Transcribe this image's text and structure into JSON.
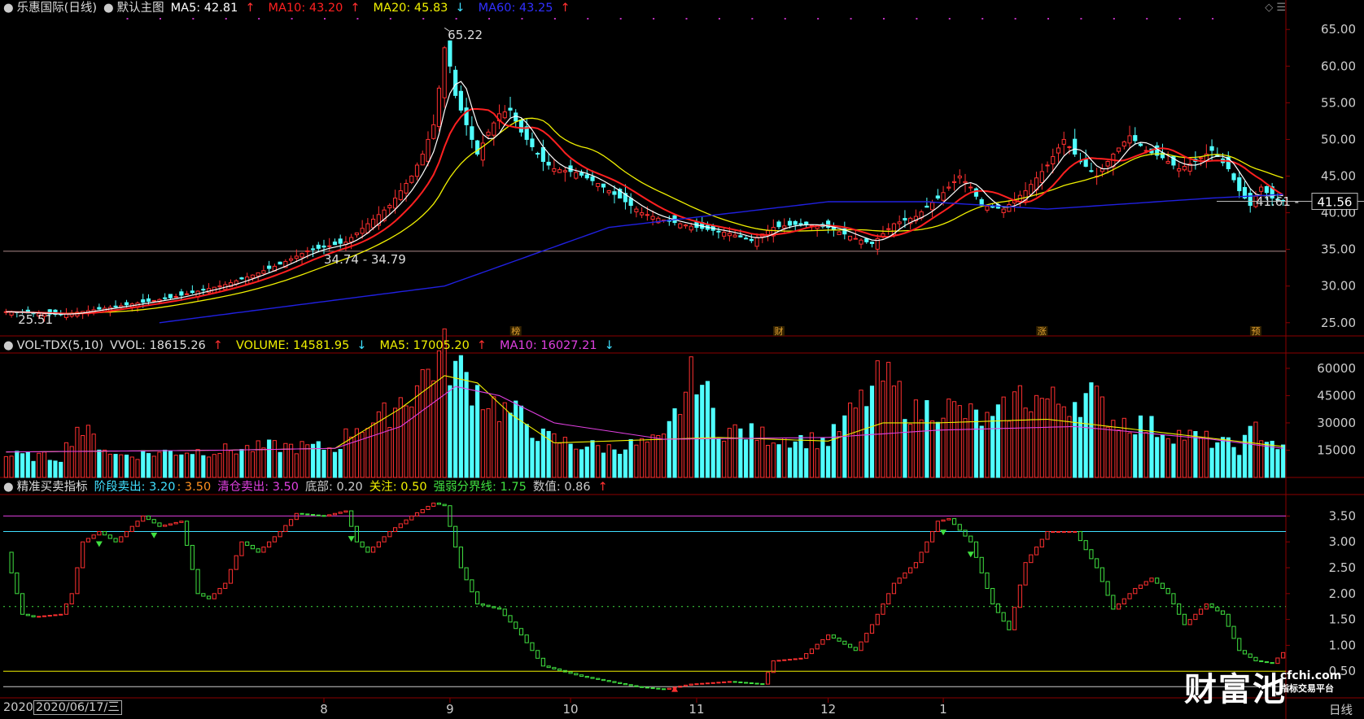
{
  "header1": {
    "stock": "乐惠国际(日线)",
    "template": "默认主图",
    "ma5": {
      "label": "MA5: 42.81",
      "dir": "up",
      "color": "#ffffff"
    },
    "ma10": {
      "label": "MA10: 43.20",
      "dir": "up",
      "color": "#ff2020"
    },
    "ma20": {
      "label": "MA20: 45.83",
      "dir": "down",
      "color": "#f0f000"
    },
    "ma60": {
      "label": "MA60: 43.25",
      "dir": "up",
      "color": "#2020ff"
    }
  },
  "header2": {
    "name": "VOL-TDX(5,10)",
    "vvol": {
      "label": "VVOL: 18615.26",
      "dir": "up",
      "color": "#dddddd"
    },
    "volume": {
      "label": "VOLUME: 14581.95",
      "dir": "down",
      "color": "#f0f000"
    },
    "ma5": {
      "label": "MA5: 17005.20",
      "dir": "up",
      "color": "#f0f000"
    },
    "ma10": {
      "label": "MA10: 16027.21",
      "dir": "down",
      "color": "#e040e0"
    }
  },
  "header3": {
    "name": "精准买卖指标",
    "stage_sell": {
      "label": "阶段卖出: 3.20",
      "color": "#40e0ff"
    },
    "stage_sell2": {
      "label": ": 3.50",
      "color": "#ff9020"
    },
    "clear_sell": {
      "label": "清仓卖出: 3.50",
      "color": "#e040e0"
    },
    "bottom": {
      "label": "底部: 0.20",
      "color": "#cccccc"
    },
    "watch": {
      "label": "关注: 0.50",
      "color": "#f0f000"
    },
    "divider": {
      "label": "强弱分界线: 1.75",
      "color": "#40e040"
    },
    "value": {
      "label": "数值: 0.86",
      "dir": "up",
      "color": "#cccccc"
    }
  },
  "footer": {
    "date_prefix": "2020",
    "date": "2020/06/17/三",
    "period": "日线"
  },
  "watermark": {
    "main": "财富池",
    "url": "cfchi.com",
    "sub": "指标交易平台"
  },
  "colors": {
    "up": "#ff3030",
    "down": "#50ffff",
    "ma5": "#ffffff",
    "ma10": "#ff2020",
    "ma20": "#f0f000",
    "ma60": "#2020e0",
    "bg": "#000000",
    "grid": "#8b0000"
  },
  "chart_data": [
    {
      "type": "candlestick",
      "panel": "price",
      "y_ticks": [
        25.0,
        30.0,
        35.0,
        40.0,
        45.0,
        50.0,
        55.0,
        60.0,
        65.0
      ],
      "ylim": [
        23.2,
        66.8
      ],
      "x_labels": [
        "8",
        "9",
        "10",
        "11",
        "12",
        "1"
      ],
      "annotations": [
        {
          "text": "65.22",
          "value": 65.22
        },
        {
          "text": "34.74 - 34.79",
          "value": 34.75
        },
        {
          "text": "25.51",
          "value": 25.51
        },
        {
          "text": "41.61 -",
          "value": 41.61
        }
      ],
      "current_price": {
        "text": "41.56",
        "value": 41.56
      },
      "h_line": 34.75,
      "markers": [
        "榜",
        "财",
        "涨",
        "预"
      ],
      "close_points": [
        [
          0,
          26.5
        ],
        [
          10,
          26.1
        ],
        [
          20,
          27.2
        ],
        [
          30,
          28.4
        ],
        [
          40,
          30.2
        ],
        [
          45,
          31.5
        ],
        [
          50,
          33.0
        ],
        [
          55,
          34.8
        ],
        [
          62,
          36.0
        ],
        [
          66,
          38.5
        ],
        [
          70,
          41.0
        ],
        [
          74,
          45.0
        ],
        [
          76,
          48.0
        ],
        [
          78,
          52.0
        ],
        [
          79,
          57.0
        ],
        [
          80,
          62.5
        ],
        [
          81,
          60.0
        ],
        [
          82,
          56.0
        ],
        [
          84,
          52.0
        ],
        [
          86,
          48.0
        ],
        [
          88,
          51.0
        ],
        [
          90,
          53.5
        ],
        [
          92,
          54.0
        ],
        [
          94,
          51.0
        ],
        [
          96,
          49.0
        ],
        [
          98,
          47.0
        ],
        [
          100,
          46.0
        ],
        [
          104,
          45.5
        ],
        [
          108,
          44.0
        ],
        [
          112,
          42.0
        ],
        [
          116,
          40.0
        ],
        [
          120,
          39.0
        ],
        [
          126,
          38.0
        ],
        [
          132,
          37.2
        ],
        [
          136,
          36.2
        ],
        [
          140,
          38.0
        ],
        [
          145,
          38.5
        ],
        [
          150,
          38.0
        ],
        [
          155,
          36.5
        ],
        [
          158,
          35.8
        ],
        [
          162,
          38.5
        ],
        [
          166,
          39.5
        ],
        [
          170,
          42.0
        ],
        [
          174,
          45.0
        ],
        [
          176,
          43.5
        ],
        [
          178,
          41.0
        ],
        [
          182,
          40.5
        ],
        [
          186,
          43.0
        ],
        [
          190,
          46.5
        ],
        [
          193,
          50.0
        ],
        [
          196,
          47.0
        ],
        [
          199,
          45.0
        ],
        [
          202,
          48.0
        ],
        [
          205,
          50.5
        ],
        [
          208,
          48.5
        ],
        [
          211,
          47.5
        ],
        [
          214,
          46.0
        ],
        [
          217,
          47.0
        ],
        [
          220,
          48.5
        ],
        [
          223,
          46.0
        ],
        [
          225,
          43.0
        ],
        [
          227,
          41.0
        ],
        [
          229,
          43.5
        ],
        [
          231,
          42.0
        ],
        [
          233,
          41.56
        ]
      ],
      "ma60_points": [
        [
          28,
          25.0
        ],
        [
          80,
          30.0
        ],
        [
          110,
          38.0
        ],
        [
          150,
          41.5
        ],
        [
          168,
          41.5
        ],
        [
          190,
          40.5
        ],
        [
          220,
          42.0
        ],
        [
          233,
          42.5
        ]
      ]
    },
    {
      "type": "bar",
      "panel": "volume",
      "y_ticks": [
        15000,
        30000,
        45000,
        60000
      ],
      "ylim": [
        0,
        68000
      ],
      "points": [
        [
          0,
          12000
        ],
        [
          10,
          11000
        ],
        [
          13,
          28000
        ],
        [
          20,
          12000
        ],
        [
          30,
          14000
        ],
        [
          40,
          15000
        ],
        [
          50,
          17000
        ],
        [
          60,
          16000
        ],
        [
          64,
          29000
        ],
        [
          68,
          30000
        ],
        [
          72,
          43000
        ],
        [
          74,
          47000
        ],
        [
          78,
          63000
        ],
        [
          80,
          67000
        ],
        [
          82,
          60000
        ],
        [
          84,
          55000
        ],
        [
          86,
          48000
        ],
        [
          90,
          38000
        ],
        [
          94,
          33000
        ],
        [
          98,
          22000
        ],
        [
          104,
          18000
        ],
        [
          110,
          16000
        ],
        [
          120,
          20000
        ],
        [
          126,
          60000
        ],
        [
          130,
          27000
        ],
        [
          140,
          22000
        ],
        [
          150,
          20000
        ],
        [
          160,
          55000
        ],
        [
          166,
          35000
        ],
        [
          170,
          40000
        ],
        [
          180,
          30000
        ],
        [
          185,
          45000
        ],
        [
          192,
          41000
        ],
        [
          198,
          45000
        ],
        [
          202,
          32000
        ],
        [
          206,
          30000
        ],
        [
          212,
          25000
        ],
        [
          220,
          20000
        ],
        [
          225,
          16000
        ],
        [
          228,
          27000
        ],
        [
          233,
          15000
        ]
      ],
      "ma5_points": [
        [
          0,
          14000
        ],
        [
          40,
          15000
        ],
        [
          60,
          16000
        ],
        [
          72,
          38000
        ],
        [
          80,
          56000
        ],
        [
          86,
          52000
        ],
        [
          92,
          35000
        ],
        [
          100,
          19000
        ],
        [
          130,
          22000
        ],
        [
          150,
          20000
        ],
        [
          160,
          30000
        ],
        [
          170,
          30000
        ],
        [
          190,
          32000
        ],
        [
          210,
          25000
        ],
        [
          233,
          17005
        ]
      ],
      "ma10_points": [
        [
          0,
          14000
        ],
        [
          40,
          15000
        ],
        [
          60,
          16000
        ],
        [
          72,
          28000
        ],
        [
          82,
          50000
        ],
        [
          90,
          45000
        ],
        [
          100,
          30000
        ],
        [
          120,
          21000
        ],
        [
          150,
          22000
        ],
        [
          170,
          26000
        ],
        [
          195,
          28000
        ],
        [
          220,
          21000
        ],
        [
          233,
          16027
        ]
      ]
    },
    {
      "type": "line",
      "panel": "indicator",
      "y_ticks": [
        0.5,
        1.0,
        1.5,
        2.0,
        2.5,
        3.0,
        3.5
      ],
      "ylim": [
        0.0,
        3.9
      ],
      "h_lines": [
        {
          "value": 3.5,
          "color": "#e040e0"
        },
        {
          "value": 3.2,
          "color": "#40e0ff"
        },
        {
          "value": 1.75,
          "color": "#40e040",
          "dashed": true
        },
        {
          "value": 0.5,
          "color": "#f0f000"
        },
        {
          "value": 0.2,
          "color": "#cccccc"
        }
      ],
      "points": [
        [
          0,
          2.8
        ],
        [
          3,
          1.6
        ],
        [
          5,
          1.55
        ],
        [
          10,
          1.6
        ],
        [
          12,
          2.0
        ],
        [
          14,
          3.0
        ],
        [
          17,
          3.2
        ],
        [
          20,
          3.0
        ],
        [
          25,
          3.5
        ],
        [
          28,
          3.3
        ],
        [
          32,
          3.4
        ],
        [
          35,
          2.0
        ],
        [
          37,
          1.9
        ],
        [
          40,
          2.2
        ],
        [
          43,
          3.0
        ],
        [
          46,
          2.8
        ],
        [
          50,
          3.2
        ],
        [
          53,
          3.55
        ],
        [
          58,
          3.5
        ],
        [
          62,
          3.6
        ],
        [
          64,
          3.0
        ],
        [
          66,
          2.8
        ],
        [
          70,
          3.2
        ],
        [
          74,
          3.5
        ],
        [
          78,
          3.75
        ],
        [
          80,
          3.7
        ],
        [
          83,
          2.5
        ],
        [
          86,
          1.8
        ],
        [
          90,
          1.7
        ],
        [
          94,
          1.2
        ],
        [
          98,
          0.6
        ],
        [
          105,
          0.4
        ],
        [
          115,
          0.2
        ],
        [
          120,
          0.15
        ],
        [
          125,
          0.25
        ],
        [
          132,
          0.3
        ],
        [
          138,
          0.25
        ],
        [
          140,
          0.7
        ],
        [
          145,
          0.75
        ],
        [
          150,
          1.2
        ],
        [
          155,
          0.9
        ],
        [
          158,
          1.4
        ],
        [
          162,
          2.2
        ],
        [
          166,
          2.6
        ],
        [
          170,
          3.4
        ],
        [
          172,
          3.45
        ],
        [
          176,
          3.0
        ],
        [
          180,
          1.8
        ],
        [
          183,
          1.3
        ],
        [
          186,
          2.6
        ],
        [
          190,
          3.2
        ],
        [
          195,
          3.2
        ],
        [
          199,
          2.5
        ],
        [
          202,
          1.7
        ],
        [
          206,
          2.1
        ],
        [
          209,
          2.3
        ],
        [
          212,
          2.0
        ],
        [
          215,
          1.4
        ],
        [
          219,
          1.8
        ],
        [
          222,
          1.6
        ],
        [
          225,
          0.9
        ],
        [
          228,
          0.7
        ],
        [
          231,
          0.65
        ],
        [
          233,
          0.86
        ]
      ]
    }
  ]
}
